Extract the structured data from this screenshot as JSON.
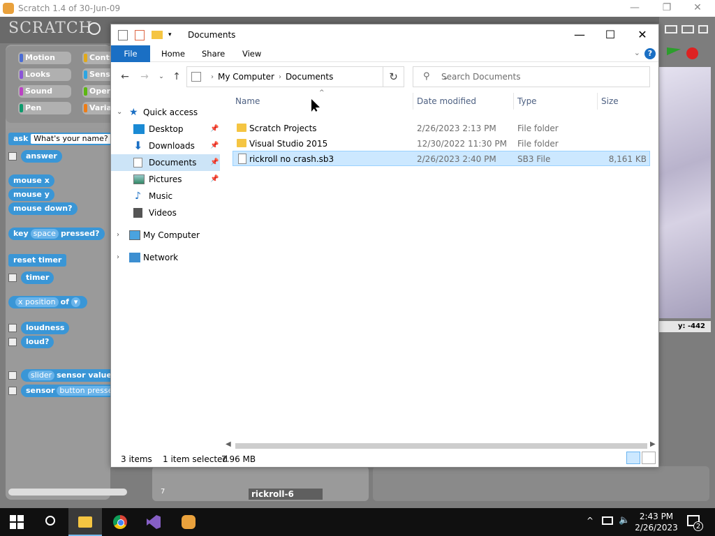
{
  "scratch": {
    "window_title": "Scratch 1.4 of 30-Jun-09",
    "logo": "SCRATCH",
    "categories": [
      {
        "label": "Motion",
        "color": "#4a6cd4"
      },
      {
        "label": "Control",
        "color": "#e1a91a"
      },
      {
        "label": "Looks",
        "color": "#8a55d7"
      },
      {
        "label": "Sensing",
        "color": "#2ca5e2"
      },
      {
        "label": "Sound",
        "color": "#bb42c3"
      },
      {
        "label": "Operators",
        "color": "#5cb712"
      },
      {
        "label": "Pen",
        "color": "#0e9a6c"
      },
      {
        "label": "Variables",
        "color": "#ee7d16"
      }
    ],
    "blocks": {
      "ask": "ask",
      "ask_value": "What's your name?",
      "answer": "answer",
      "mouse_x": "mouse x",
      "mouse_y": "mouse y",
      "mouse_down": "mouse down?",
      "key": "key",
      "key_value": "space",
      "pressed": "pressed?",
      "reset_timer": "reset timer",
      "timer": "timer",
      "x_position": "x position",
      "of": "of",
      "loudness": "loudness",
      "loud": "loud?",
      "slider": "slider",
      "sensor_value": "sensor value",
      "sensor": "sensor",
      "button_pressed": "button pressed"
    },
    "y_readout": "y: -442",
    "sprite_number": "7",
    "sprite_name": "rickroll-6"
  },
  "explorer": {
    "title": "Documents",
    "ribbon_tabs": [
      "File",
      "Home",
      "Share",
      "View"
    ],
    "breadcrumb": [
      "My Computer",
      "Documents"
    ],
    "search_placeholder": "Search Documents",
    "nav": {
      "quick_access": "Quick access",
      "items": [
        "Desktop",
        "Downloads",
        "Documents",
        "Pictures",
        "Music",
        "Videos"
      ],
      "my_computer": "My Computer",
      "network": "Network"
    },
    "columns": [
      "Name",
      "Date modified",
      "Type",
      "Size"
    ],
    "files": [
      {
        "name": "Scratch Projects",
        "date": "2/26/2023 2:13 PM",
        "type": "File folder",
        "size": "",
        "kind": "folder"
      },
      {
        "name": "Visual Studio 2015",
        "date": "12/30/2022 11:30 PM",
        "type": "File folder",
        "size": "",
        "kind": "folder"
      },
      {
        "name": "rickroll no crash.sb3",
        "date": "2/26/2023 2:40 PM",
        "type": "SB3 File",
        "size": "8,161 KB",
        "kind": "file"
      }
    ],
    "status": {
      "items": "3 items",
      "selected": "1 item selected",
      "size": "7.96 MB"
    }
  },
  "taskbar": {
    "time": "2:43 PM",
    "date": "2/26/2023",
    "notification_count": "2"
  }
}
